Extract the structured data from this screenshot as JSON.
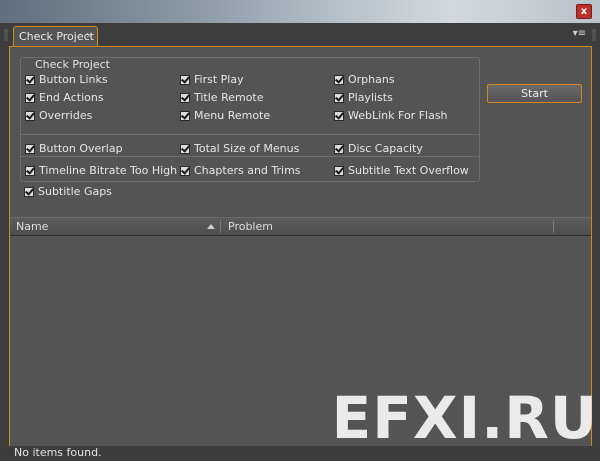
{
  "tab": {
    "title": "Check Project",
    "close_glyph": "×"
  },
  "panel_menu_glyph": "▾≡",
  "group": {
    "title": "Check Project"
  },
  "checkboxes": [
    {
      "label": "Button Links",
      "checked": true
    },
    {
      "label": "First Play",
      "checked": true
    },
    {
      "label": "Orphans",
      "checked": true
    },
    {
      "label": "End Actions",
      "checked": true
    },
    {
      "label": "Title Remote",
      "checked": true
    },
    {
      "label": "Playlists",
      "checked": true
    },
    {
      "label": "Overrides",
      "checked": true
    },
    {
      "label": "Menu Remote",
      "checked": true
    },
    {
      "label": "WebLink For Flash",
      "checked": true
    },
    {
      "label": "Button Overlap",
      "checked": true
    },
    {
      "label": "Total Size of Menus",
      "checked": true
    },
    {
      "label": "Disc Capacity",
      "checked": true
    },
    {
      "label": "Timeline Bitrate Too High",
      "checked": true
    },
    {
      "label": "Chapters and Trims",
      "checked": true
    },
    {
      "label": "Subtitle Text Overflow",
      "checked": true
    },
    {
      "label": "Subtitle Gaps",
      "checked": true
    }
  ],
  "start_button": "Start",
  "table": {
    "columns": [
      "Name",
      "Problem"
    ],
    "rows": []
  },
  "status": "No items found.",
  "window_close_glyph": "x",
  "watermark": "EFXI.RU",
  "colors": {
    "accent": "#d08a1c",
    "panel_bg": "#545454",
    "frame_bg": "#3d3d3d"
  }
}
